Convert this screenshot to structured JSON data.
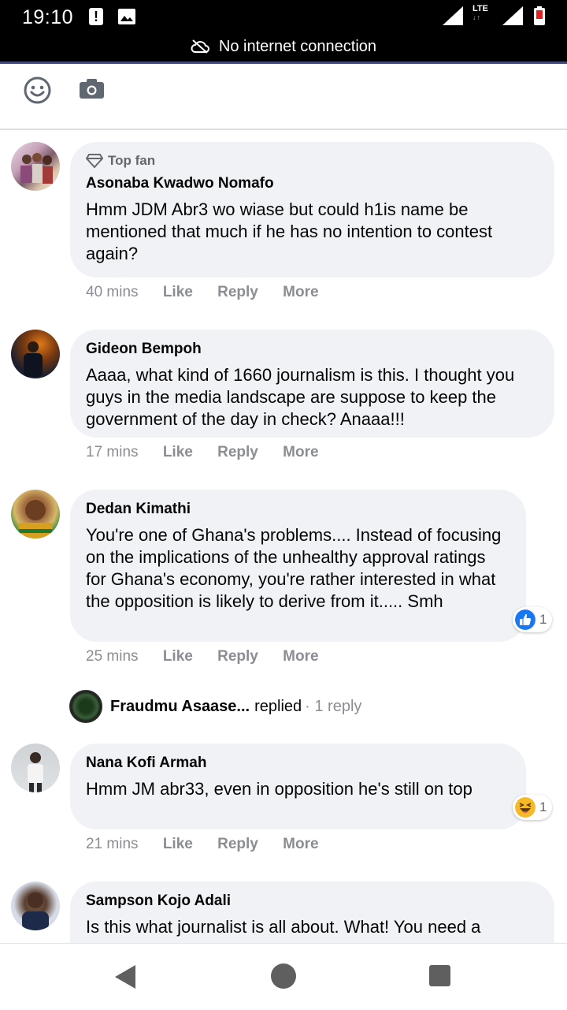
{
  "status_bar": {
    "time": "19:10",
    "network_type": "LTE",
    "no_internet": "No internet connection"
  },
  "comments": [
    {
      "badge": "Top fan",
      "author": "Asonaba Kwadwo Nomafo",
      "text": "Hmm JDM Abr3 wo wiase but could h1is name be mentioned that much if he has no intention to contest again?",
      "time": "40 mins",
      "actions": [
        "Like",
        "Reply",
        "More"
      ]
    },
    {
      "author": "Gideon Bempoh",
      "text": "Aaaa, what kind of 1660 journalism is this. I thought you guys in the media landscape are suppose to keep the government of the day in check? Anaaa!!!",
      "time": "17 mins",
      "actions": [
        "Like",
        "Reply",
        "More"
      ]
    },
    {
      "author": "Dedan Kimathi",
      "text": "You're one of Ghana's problems.... Instead of focusing on the implications of the unhealthy approval ratings for Ghana's economy, you're rather interested in what the opposition is likely to derive from it..... Smh",
      "time": "25 mins",
      "actions": [
        "Like",
        "Reply",
        "More"
      ],
      "reaction": {
        "type": "like",
        "count": "1"
      }
    },
    {
      "author": "Nana Kofi Armah",
      "text": "Hmm JM abr33, even in opposition he's still on top",
      "time": "21 mins",
      "actions": [
        "Like",
        "Reply",
        "More"
      ],
      "reaction": {
        "type": "haha",
        "count": "1"
      }
    },
    {
      "author": "Sampson Kojo Adali",
      "text": "Is this what journalist is all about. What! You need a"
    }
  ],
  "reply_summary": {
    "name": "Fraudmu Asaase...",
    "verb": "replied",
    "count": "· 1 reply"
  },
  "colors": {
    "bubble": "#f0f2f5",
    "meta": "#8a8d91",
    "like_blue": "#1877f2",
    "haha_yellow": "#f7b928"
  }
}
